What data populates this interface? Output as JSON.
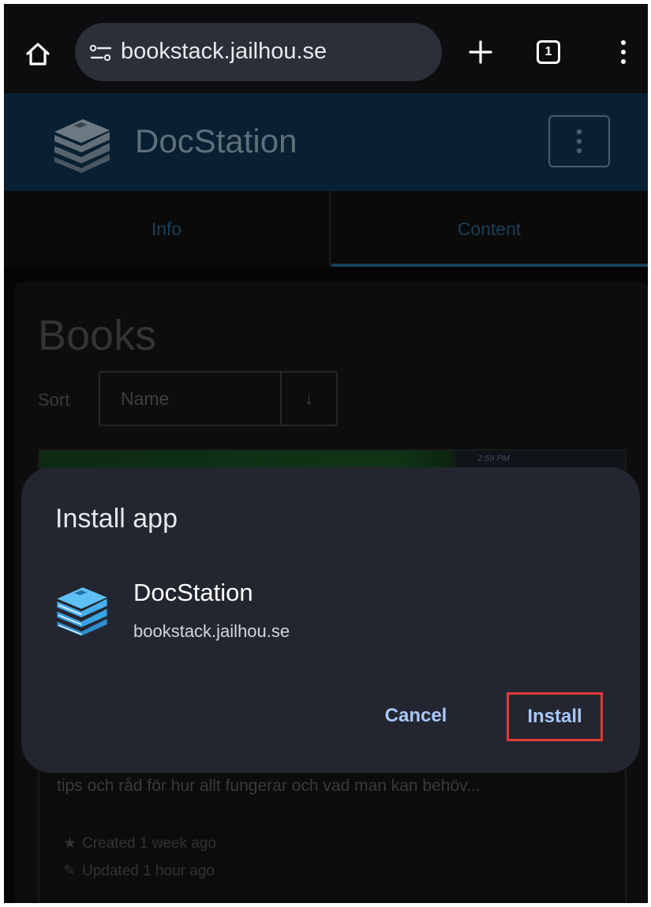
{
  "browser": {
    "url": "bookstack.jailhou.se",
    "tab_count": "1"
  },
  "site": {
    "name": "DocStation"
  },
  "tabs": [
    {
      "label": "Info"
    },
    {
      "label": "Content"
    }
  ],
  "main": {
    "title": "Books",
    "sort_label": "Sort",
    "sort_value": "Name",
    "sort_direction_icon": "↓",
    "book": {
      "description": "tips och råd för hur allt fungerar och vad man kan behöv...",
      "created": "Created 1 week ago",
      "updated": "Updated 1 hour ago",
      "cover_status": "2:59 PM"
    }
  },
  "install_dialog": {
    "title": "Install app",
    "app_name": "DocStation",
    "app_url": "bookstack.jailhou.se",
    "cancel_label": "Cancel",
    "install_label": "Install"
  },
  "colors": {
    "dialog_bg": "#232630",
    "button_text": "#a8c7fa",
    "highlight": "#e23b3b",
    "header_bg": "#082031",
    "app_icon": "#3aa3e3"
  },
  "icons": {
    "home": "home-icon",
    "site_settings": "site-settings-icon",
    "new_tab": "plus-icon",
    "tabs": "tab-switcher-icon",
    "menu": "more-vertical-icon",
    "logo": "book-stack-icon"
  }
}
